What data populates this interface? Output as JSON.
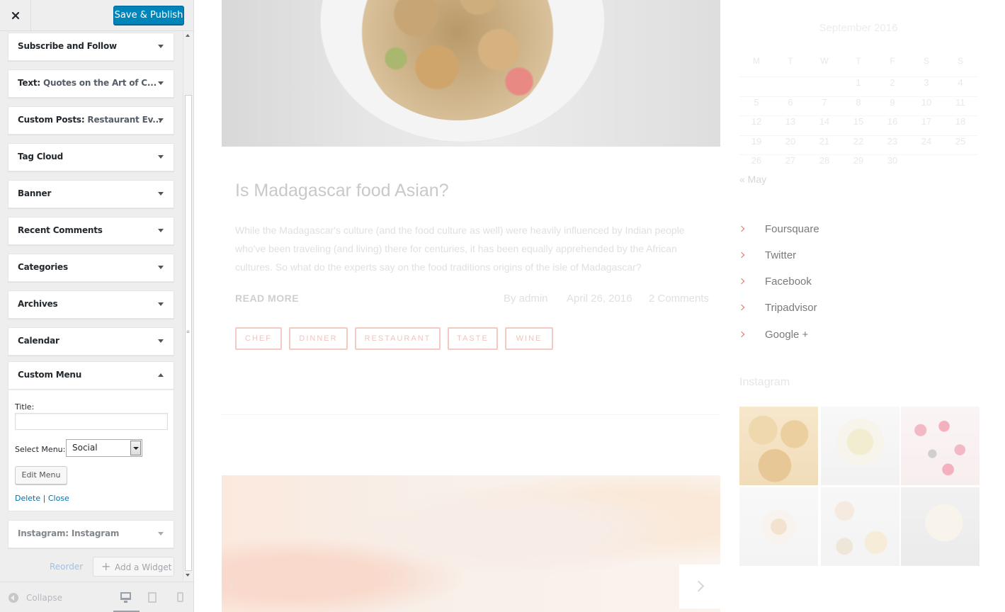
{
  "customizer": {
    "close_icon": "close-icon",
    "save_label": "Save & Publish",
    "widgets": [
      {
        "name": "Subscribe and Follow",
        "sub": "",
        "state": "collapsed"
      },
      {
        "name": "Text:",
        "sub": " Quotes on the Art of C...",
        "state": "collapsed"
      },
      {
        "name": "Custom Posts:",
        "sub": " Restaurant Ev...",
        "state": "collapsed"
      },
      {
        "name": "Tag Cloud",
        "sub": "",
        "state": "collapsed"
      },
      {
        "name": "Banner",
        "sub": "",
        "state": "collapsed"
      },
      {
        "name": "Recent Comments",
        "sub": "",
        "state": "collapsed"
      },
      {
        "name": "Categories",
        "sub": "",
        "state": "collapsed"
      },
      {
        "name": "Archives",
        "sub": "",
        "state": "collapsed"
      },
      {
        "name": "Calendar",
        "sub": "",
        "state": "collapsed"
      },
      {
        "name": "Custom Menu",
        "sub": "",
        "state": "expanded"
      },
      {
        "name": "Instagram:",
        "sub": " Instagram",
        "state": "dimmed"
      }
    ],
    "custom_menu": {
      "title_label": "Title:",
      "title_value": "",
      "select_label": "Select Menu:",
      "select_value": "Social",
      "edit_button": "Edit Menu",
      "delete_link": "Delete",
      "separator": " | ",
      "close_link": "Close"
    },
    "reorder_label": "Reorder",
    "add_widget_label": "Add a Widget",
    "collapse_label": "Collapse",
    "devices": [
      "desktop-icon",
      "tablet-icon",
      "mobile-icon"
    ]
  },
  "preview": {
    "post": {
      "title": "Is Madagascar food Asian?",
      "excerpt": "While the Madagascar's culture (and the food culture as well) were heavily influenced by Indian people who've been traveling (and living) there for centuries, it has been equally apprehended by the African cultures. So what do the experts say on the food traditions origins of the isle of Madagascar?",
      "read_more": "READ MORE",
      "author": "By admin",
      "date": "April 26, 2016",
      "comments": "2 Comments",
      "tags": [
        "CHEF",
        "DINNER",
        "RESTAURANT",
        "TASTE",
        "WINE"
      ]
    },
    "calendar": {
      "caption": "September 2016",
      "weekdays": [
        "M",
        "T",
        "W",
        "T",
        "F",
        "S",
        "S"
      ],
      "weeks": [
        [
          "",
          "",
          "",
          "1",
          "2",
          "3",
          "4"
        ],
        [
          "5",
          "6",
          "7",
          "8",
          "9",
          "10",
          "11"
        ],
        [
          "12",
          "13",
          "14",
          "15",
          "16",
          "17",
          "18"
        ],
        [
          "19",
          "20",
          "21",
          "22",
          "23",
          "24",
          "25"
        ],
        [
          "26",
          "27",
          "28",
          "29",
          "30",
          "",
          ""
        ]
      ],
      "prev_link": "« May"
    },
    "social_menu": [
      "Foursquare",
      "Twitter",
      "Facebook",
      "Tripadvisor",
      "Google +"
    ],
    "instagram_title": "Instagram",
    "colors": {
      "accent": "#0085ba",
      "link": "#0073aa",
      "tag_border": "#f3c9c2",
      "social_chevron": "#e0735f"
    }
  }
}
